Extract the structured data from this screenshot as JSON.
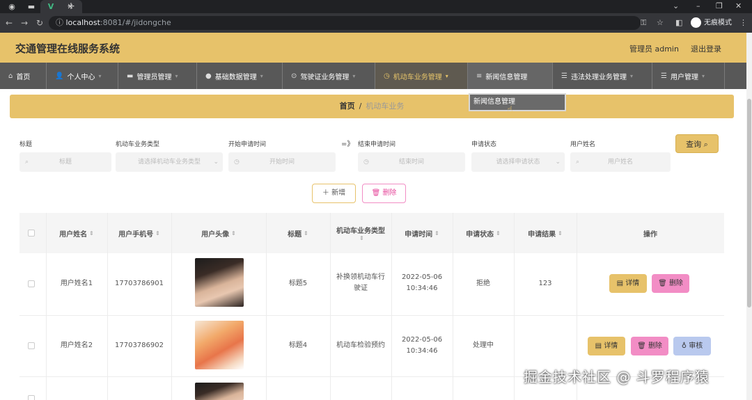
{
  "browser": {
    "url_host": "localhost",
    "url_rest": ":8081/#/jidongche",
    "incognito_label": "无痕模式",
    "icons": [
      "chrome-icon",
      "tab-icon",
      "vue-icon",
      "close-icon",
      "new-tab-icon"
    ]
  },
  "header": {
    "title": "交通管理在线服务系统",
    "admin": "管理员 admin",
    "logout": "退出登录"
  },
  "nav": {
    "items": [
      {
        "label": "首页",
        "icon": "⌂"
      },
      {
        "label": "个人中心",
        "icon": "👤"
      },
      {
        "label": "管理员管理",
        "icon": "▬"
      },
      {
        "label": "基础数据管理",
        "icon": "●"
      },
      {
        "label": "驾驶证业务管理",
        "icon": "⊙"
      },
      {
        "label": "机动车业务管理",
        "icon": "◷"
      },
      {
        "label": "新闻信息管理",
        "icon": "≡"
      },
      {
        "label": "违法处理业务管理",
        "icon": "☰"
      },
      {
        "label": "用户管理",
        "icon": "☰"
      }
    ],
    "dropdown_item": "新闻信息管理"
  },
  "breadcrumb": {
    "home": "首页",
    "sep": "/",
    "current": "机动车业务"
  },
  "filters": {
    "title_label": "标题",
    "title_ph": "标题",
    "type_label": "机动车业务类型",
    "type_ph": "请选择机动车业务类型",
    "start_label": "开始申请时间",
    "start_ph": "开始时间",
    "arrow": "=》",
    "end_label": "结束申请时间",
    "end_ph": "结束时间",
    "status_label": "申请状态",
    "status_ph": "请选择申请状态",
    "user_label": "用户姓名",
    "user_ph": "用户姓名",
    "query": "查询"
  },
  "actions": {
    "add": "新增",
    "delete": "删除"
  },
  "table": {
    "headers": [
      "用户姓名",
      "用户手机号",
      "用户头像",
      "标题",
      "机动车业务类型",
      "申请时间",
      "申请状态",
      "申请结果",
      "操作"
    ],
    "rows": [
      {
        "name": "用户姓名1",
        "phone": "17703786901",
        "title": "标题5",
        "type": "补换领机动车行驶证",
        "time": "2022-05-06 10:34:46",
        "status": "拒绝",
        "result": "123",
        "buttons": [
          "详情",
          "删除"
        ]
      },
      {
        "name": "用户姓名2",
        "phone": "17703786902",
        "title": "标题4",
        "type": "机动车检验预约",
        "time": "2022-05-06 10:34:46",
        "status": "处理中",
        "result": "",
        "buttons": [
          "详情",
          "删除",
          "审核"
        ]
      }
    ]
  },
  "watermark": "掘金技术社区 @ 斗罗程序猿"
}
